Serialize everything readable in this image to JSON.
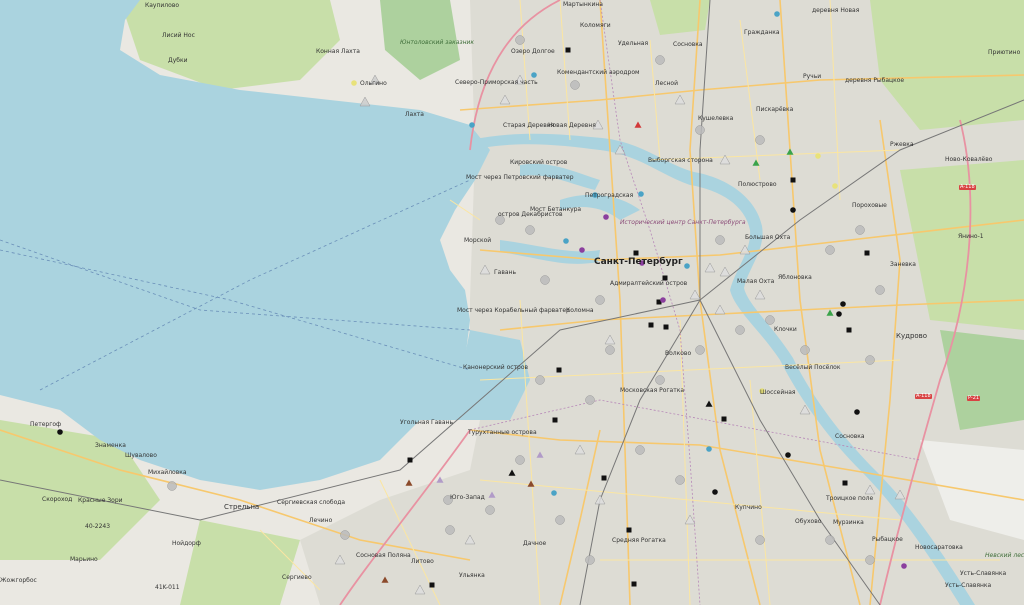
{
  "map": {
    "colors": {
      "water": "#aad3df",
      "land": "#eae8e2",
      "urban": "#dddcd4",
      "park": "#c8dfa9",
      "forest": "#add19e",
      "major_road": "#f7c86d",
      "secondary_road": "#fbe6a2",
      "motorway": "#e892a2",
      "rail": "#777777",
      "district_border": "#b788b8"
    },
    "labels": [
      {
        "text": "Каупилово",
        "cls": ""
      },
      {
        "text": "Мартынкина",
        "cls": ""
      },
      {
        "text": "деревня Новая",
        "cls": ""
      },
      {
        "text": "Лисий Нос",
        "cls": ""
      },
      {
        "text": "Коломяги",
        "cls": ""
      },
      {
        "text": "Гражданка",
        "cls": ""
      },
      {
        "text": "Дубки",
        "cls": ""
      },
      {
        "text": "Конная Лахта",
        "cls": ""
      },
      {
        "text": "Юнтоловский заказник",
        "cls": "green"
      },
      {
        "text": "Озеро Долгое",
        "cls": ""
      },
      {
        "text": "Удельная",
        "cls": ""
      },
      {
        "text": "Сосновка",
        "cls": ""
      },
      {
        "text": "Ручьи",
        "cls": ""
      },
      {
        "text": "Приютино",
        "cls": ""
      },
      {
        "text": "Ольгино",
        "cls": ""
      },
      {
        "text": "Северо-Приморская часть",
        "cls": ""
      },
      {
        "text": "Комендантский аэродром",
        "cls": ""
      },
      {
        "text": "Лесной",
        "cls": ""
      },
      {
        "text": "деревня Рыбацкое",
        "cls": ""
      },
      {
        "text": "Лахта",
        "cls": ""
      },
      {
        "text": "Старая Деревня",
        "cls": ""
      },
      {
        "text": "Новая Деревня",
        "cls": ""
      },
      {
        "text": "Кушелевка",
        "cls": ""
      },
      {
        "text": "Пискарёвка",
        "cls": ""
      },
      {
        "text": "Ржевка",
        "cls": ""
      },
      {
        "text": "Ново-Ковалёво",
        "cls": ""
      },
      {
        "text": "Кировский остров",
        "cls": ""
      },
      {
        "text": "Выборгская сторона",
        "cls": ""
      },
      {
        "text": "Полюстрово",
        "cls": ""
      },
      {
        "text": "Мост через Петровский фарватер",
        "cls": ""
      },
      {
        "text": "Петроградская",
        "cls": ""
      },
      {
        "text": "Пороховые",
        "cls": ""
      },
      {
        "text": "остров Декабристов",
        "cls": ""
      },
      {
        "text": "Мост Бетанкура",
        "cls": ""
      },
      {
        "text": "Исторический центр Санкт-Петербурга",
        "cls": "purple"
      },
      {
        "text": "Морской",
        "cls": ""
      },
      {
        "text": "Большая Охта",
        "cls": ""
      },
      {
        "text": "Янино-1",
        "cls": ""
      },
      {
        "text": "Гавань",
        "cls": ""
      },
      {
        "text": "Санкт-Петербург",
        "cls": "big"
      },
      {
        "text": "Малая Охта",
        "cls": ""
      },
      {
        "text": "Яблоновка",
        "cls": ""
      },
      {
        "text": "Заневка",
        "cls": ""
      },
      {
        "text": "Адмиралтейский остров",
        "cls": ""
      },
      {
        "text": "Мост через Корабельный фарватер",
        "cls": ""
      },
      {
        "text": "Коломна",
        "cls": ""
      },
      {
        "text": "Клочки",
        "cls": ""
      },
      {
        "text": "Кудрово",
        "cls": "mid"
      },
      {
        "text": "Канонерский остров",
        "cls": ""
      },
      {
        "text": "Волково",
        "cls": ""
      },
      {
        "text": "Весёлый Посёлок",
        "cls": ""
      },
      {
        "text": "Московская Рогатка",
        "cls": ""
      },
      {
        "text": "Шоссейная",
        "cls": ""
      },
      {
        "text": "Петергоф",
        "cls": ""
      },
      {
        "text": "Угольная Гавань",
        "cls": ""
      },
      {
        "text": "Турухтанные острова",
        "cls": ""
      },
      {
        "text": "Сосновка",
        "cls": ""
      },
      {
        "text": "Знаменка",
        "cls": ""
      },
      {
        "text": "Шувалово",
        "cls": ""
      },
      {
        "text": "Усть-Славянка",
        "cls": ""
      },
      {
        "text": "Михайловка",
        "cls": ""
      },
      {
        "text": "Стрельна",
        "cls": "mid"
      },
      {
        "text": "Сергиевская слобода",
        "cls": ""
      },
      {
        "text": "Юго-Запад",
        "cls": ""
      },
      {
        "text": "Купчино",
        "cls": ""
      },
      {
        "text": "Обухово",
        "cls": ""
      },
      {
        "text": "Мурзинка",
        "cls": ""
      },
      {
        "text": "Рыбацкое",
        "cls": ""
      },
      {
        "text": "Новосаратовка",
        "cls": ""
      },
      {
        "text": "Скороход",
        "cls": ""
      },
      {
        "text": "Красные Зори",
        "cls": ""
      },
      {
        "text": "Лечино",
        "cls": ""
      },
      {
        "text": "Дачное",
        "cls": ""
      },
      {
        "text": "Средняя Рогатка",
        "cls": ""
      },
      {
        "text": "Троицкое поле",
        "cls": ""
      },
      {
        "text": "Сосновая Поляна",
        "cls": ""
      },
      {
        "text": "Литово",
        "cls": ""
      },
      {
        "text": "Нойдорф",
        "cls": ""
      },
      {
        "text": "Марьино",
        "cls": ""
      },
      {
        "text": "Сергиево",
        "cls": ""
      },
      {
        "text": "Ульянка",
        "cls": ""
      },
      {
        "text": "Жожгорбос",
        "cls": ""
      },
      {
        "text": "Усть-Славянка",
        "cls": ""
      },
      {
        "text": "Невский лесопарк",
        "cls": "green"
      },
      {
        "text": "A-118",
        "cls": "road"
      },
      {
        "text": "A-118",
        "cls": "road"
      },
      {
        "text": "P-21",
        "cls": "road"
      },
      {
        "text": "41K-011",
        "cls": ""
      },
      {
        "text": "40-2243",
        "cls": ""
      }
    ]
  }
}
